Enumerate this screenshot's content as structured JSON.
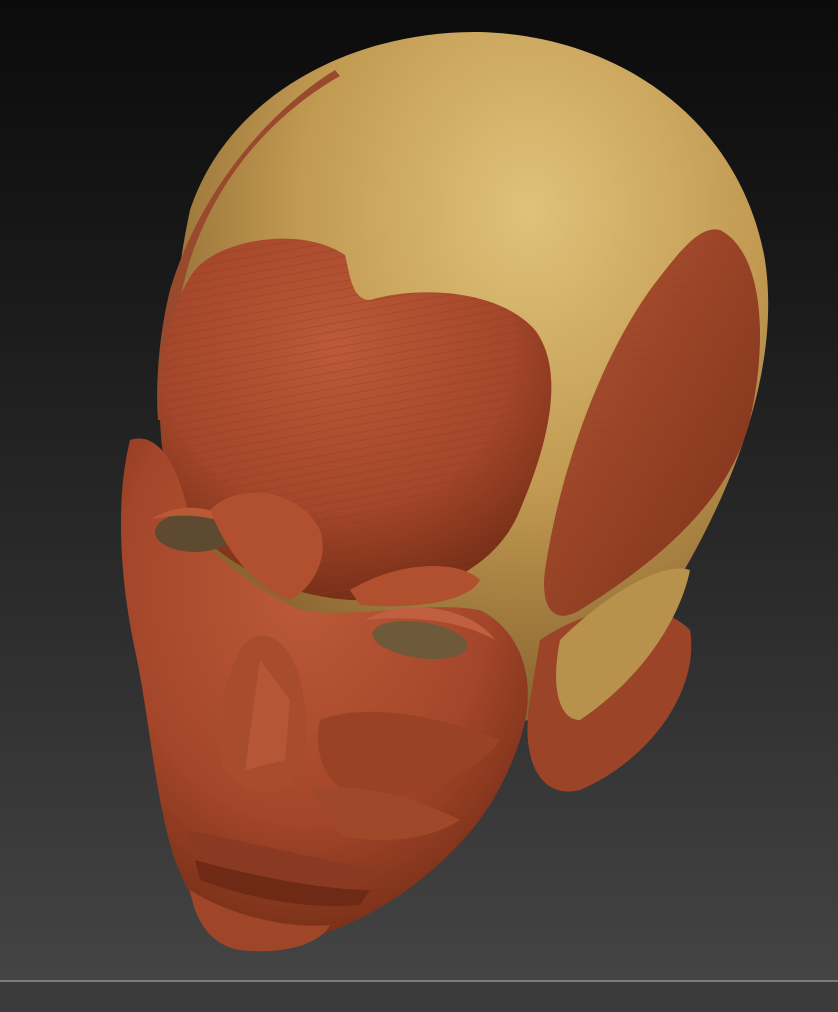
{
  "scene": {
    "subject": "sculpted-head-muscle-model",
    "colors": {
      "background_top": "#0b0b0b",
      "background_bottom": "#444444",
      "skull": "#c9a45a",
      "muscle": "#a8492c",
      "muscle_dark": "#7a3018",
      "eye_socket": "#6e5a3a",
      "bottom_bar": "#3b3b3b"
    }
  }
}
